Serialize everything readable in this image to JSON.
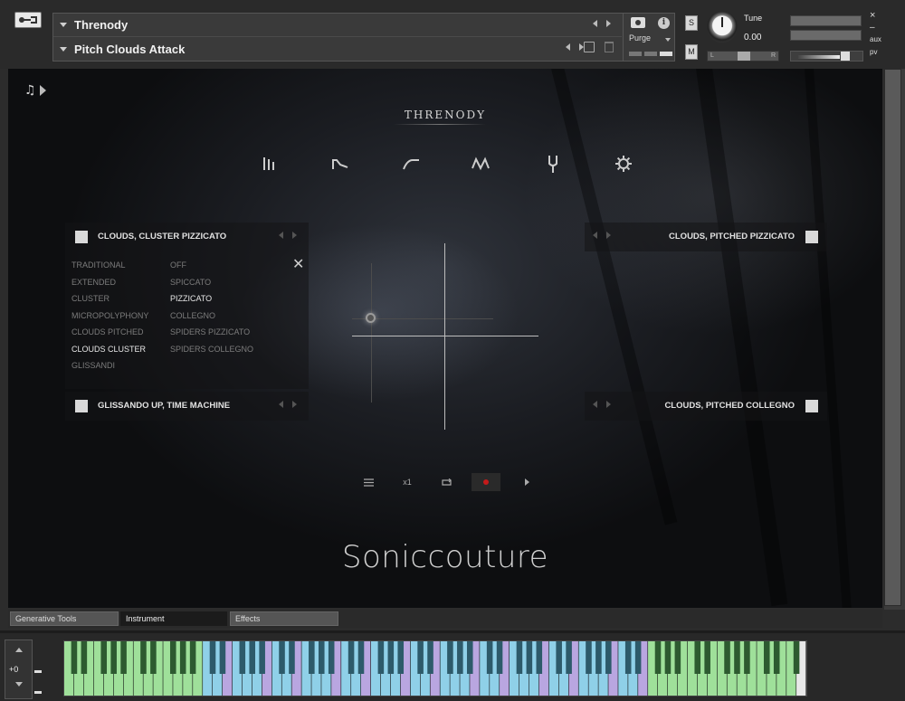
{
  "header": {
    "instrument_name": "Threnody",
    "snapshot_name": "Pitch Clouds Attack",
    "purge_label": "Purge",
    "solo_label": "S",
    "mute_label": "M",
    "tune_label": "Tune",
    "tune_value": "0.00",
    "pan_left": "L",
    "pan_right": "R",
    "close_glyph": "×",
    "minimize_glyph": "–",
    "aux_label": "aux",
    "pv_label": "pv",
    "info_glyph": "i"
  },
  "instrument": {
    "title": "THRENODY",
    "brand": "Soniccouture",
    "note_glyph": "♫",
    "close_glyph": "✕",
    "tab_icons": [
      "mixer-icon",
      "envelope-decay-icon",
      "envelope-attack-icon",
      "lfo-wave-icon",
      "tuning-fork-icon",
      "gear-icon"
    ],
    "slot_top_left": "CLOUDS, CLUSTER PIZZICATO",
    "slot_bottom_left": "GLISSANDO UP, TIME MACHINE",
    "slot_top_right": "CLOUDS, PITCHED PIZZICATO",
    "slot_bottom_right": "CLOUDS, PITCHED COLLEGNO",
    "categories": [
      {
        "label": "TRADITIONAL",
        "active": false
      },
      {
        "label": "EXTENDED",
        "active": false
      },
      {
        "label": "CLUSTER",
        "active": false
      },
      {
        "label": "MICROPOLYPHONY",
        "active": false
      },
      {
        "label": "CLOUDS PITCHED",
        "active": false
      },
      {
        "label": "CLOUDS CLUSTER",
        "active": true
      },
      {
        "label": "GLISSANDI",
        "active": false
      }
    ],
    "articulations": [
      {
        "label": "OFF",
        "active": false
      },
      {
        "label": "SPICCATO",
        "active": false
      },
      {
        "label": "PIZZICATO",
        "active": true
      },
      {
        "label": "COLLEGNO",
        "active": false
      },
      {
        "label": "SPIDERS PIZZICATO",
        "active": false
      },
      {
        "label": "SPIDERS COLLEGNO",
        "active": false
      }
    ],
    "transport": {
      "speed": "x1"
    }
  },
  "tabs": [
    {
      "label": "Generative Tools",
      "active": false
    },
    {
      "label": "Instrument",
      "active": true
    },
    {
      "label": "Effects",
      "active": false
    }
  ],
  "keyboard": {
    "octave_offset": "+0",
    "key_colors": {
      "green": "#9fe09a",
      "blue": "#8fd0e8",
      "purple": "#b9a6e0",
      "white": "#e8e8e8"
    }
  },
  "colors": {
    "record": "#c41a1a",
    "panel_bg": "#3a3a3a"
  }
}
